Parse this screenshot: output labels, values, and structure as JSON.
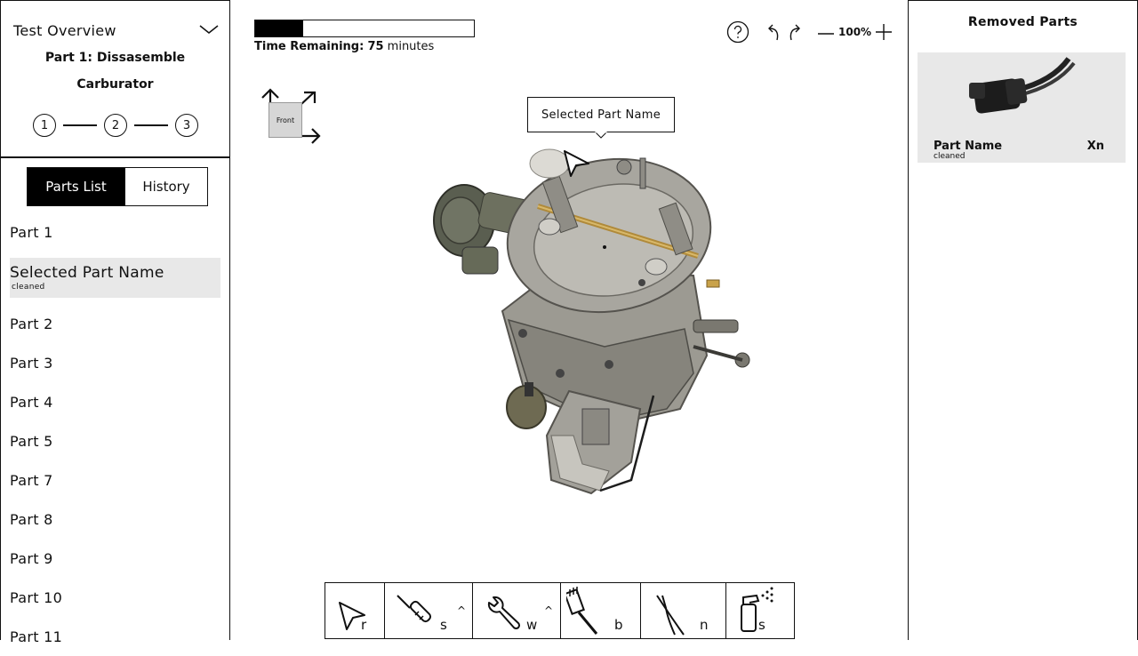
{
  "overview": {
    "title": "Test Overview",
    "part_title_line1": "Part 1: Dissasemble",
    "part_title_line2": "Carburator",
    "steps": [
      "1",
      "2",
      "3"
    ]
  },
  "tabs": {
    "parts_list": "Parts List",
    "history": "History",
    "active": "Parts List"
  },
  "parts": {
    "part1": "Part 1",
    "selected_name": "Selected Part Name",
    "selected_status": "cleaned",
    "rest": [
      "Part 2",
      "Part 3",
      "Part 4",
      "Part 5",
      "Part 7",
      "Part 8",
      "Part 9",
      "Part 10",
      "Part 11"
    ]
  },
  "timer": {
    "progress_fraction": 0.22,
    "label": "Time Remaining:",
    "value": "75",
    "unit": "minutes"
  },
  "view_controls": {
    "zoom": "100%"
  },
  "orientation": {
    "label": "Front"
  },
  "tooltip": {
    "text": "Selected Part Name"
  },
  "tools": [
    {
      "icon": "pointer-icon",
      "key": "r"
    },
    {
      "icon": "screwdriver-icon",
      "key": "s",
      "caret": "^"
    },
    {
      "icon": "wrench-icon",
      "key": "w",
      "caret": "^"
    },
    {
      "icon": "brush-icon",
      "key": "b"
    },
    {
      "icon": "pliers-icon",
      "key": "n"
    },
    {
      "icon": "spray-bottle-icon",
      "key": "s"
    }
  ],
  "removed": {
    "title": "Removed Parts",
    "items": [
      {
        "name": "Part Name",
        "qty": "Xn",
        "status": "cleaned"
      }
    ]
  },
  "colors": {
    "selected_bg": "#e8e8e8",
    "active_tab": "#000000",
    "progress": "#000000"
  }
}
